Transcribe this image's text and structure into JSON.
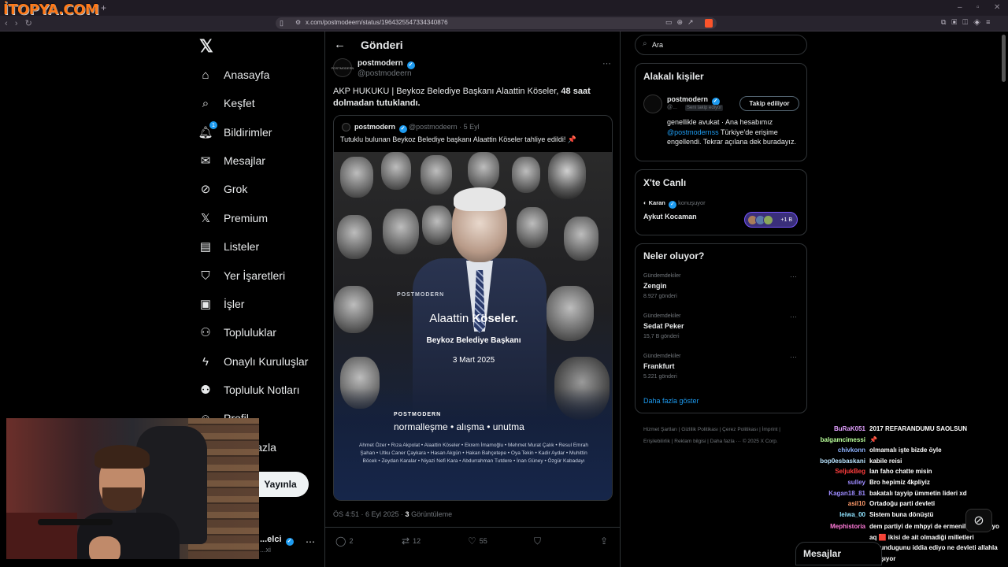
{
  "browser": {
    "stamp": "İTOPYA.COM",
    "url": "x.com/postmodeern/status/1964325547334340876"
  },
  "nav": {
    "items": [
      {
        "label": "Anasayfa",
        "icon": "home-icon"
      },
      {
        "label": "Keşfet",
        "icon": "search-icon"
      },
      {
        "label": "Bildirimler",
        "icon": "bell-icon",
        "badge": "1"
      },
      {
        "label": "Mesajlar",
        "icon": "mail-icon"
      },
      {
        "label": "Grok",
        "icon": "grok-icon"
      },
      {
        "label": "Premium",
        "icon": "x-logo-icon"
      },
      {
        "label": "Listeler",
        "icon": "list-icon"
      },
      {
        "label": "Yer İşaretleri",
        "icon": "bookmark-icon"
      },
      {
        "label": "İşler",
        "icon": "briefcase-icon"
      },
      {
        "label": "Topluluklar",
        "icon": "people-icon"
      },
      {
        "label": "Onaylı Kuruluşlar",
        "icon": "lightning-icon"
      },
      {
        "label": "Topluluk Notları",
        "icon": "community-notes-icon"
      },
      {
        "label": "Profil",
        "icon": "profile-icon"
      },
      {
        "label": "Daha fazla",
        "icon": "more-icon"
      }
    ],
    "post_button": "Yayınla",
    "account_name": "...elci",
    "account_handle": "...xi"
  },
  "post": {
    "page_title": "Gönderi",
    "author_name": "postmodern",
    "author_handle": "@postmodeern",
    "avatar_text": "POSTMODERN",
    "text_plain": "AKP HUKUKU | Beykoz Belediye Başkanı Alaattin Köseler, ",
    "text_bold": "48 saat dolmadan tutuklandı.",
    "time": "ÖS 4:51 · 6 Eyl 2025 · ",
    "views_count": "3",
    "views_label": " Görüntüleme",
    "stats": {
      "replies": "2",
      "reposts": "12",
      "likes": "55"
    }
  },
  "quote": {
    "author_name": "postmodern",
    "author_handle": "@postmodeern · 5 Eyl",
    "text": "Tutuklu bulunan Beykoz Belediye başkanı Alaattin Köseler tahliye edildi! 📌",
    "image": {
      "brand": "POSTMODERN",
      "name_first": "Alaattin ",
      "name_last": "Köseler.",
      "title": "Beykoz Belediye Başkanı",
      "date": "3 Mart 2025",
      "brand2": "POSTMODERN",
      "slogan": "normalleşme • alışma • unutma",
      "names": "Ahmet Özer • Rıza Akpolat • Alaattin Köseler • Ekrem İmamoğlu • Mehmet Murat Çalık • Resul Emrah Şahan • Utku Caner Çaykara • Hasan Akgün • Hakan Bahçetepe • Oya Tekin • Kadir Aydar • Muhittin Böcek • Zeydan Karalar • Niyazi Nefi Kara • Abdurrahman Tutdere • İnan Güney • Özgür Kabadayı"
    }
  },
  "sidebar": {
    "search_placeholder": "Ara",
    "related_title": "Alakalı kişiler",
    "related": {
      "name": "postmodern",
      "handle": "@...",
      "follows_you": "Seni takip ediyor",
      "button": "Takip ediliyor",
      "bio_1": "genellikle avukat · Ana hesabımız ",
      "bio_link": "@postmodernss",
      "bio_2": " Türkiye'de erişime engellendi. Tekrar açılana dek buradayız."
    },
    "live_title": "X'te Canlı",
    "live": {
      "host": "Karan",
      "status": " konuşuyor",
      "title": "Aykut Kocaman",
      "listeners": "+1 B"
    },
    "trends_title": "Neler oluyor?",
    "trends": [
      {
        "category": "Gündemdekiler",
        "name": "Zengin",
        "count": "8.927 gönderi"
      },
      {
        "category": "Gündemdekiler",
        "name": "Sedat Peker",
        "count": "15,7 B gönderi"
      },
      {
        "category": "Gündemdekiler",
        "name": "Frankfurt",
        "count": "5.221 gönderi"
      }
    ],
    "show_more": "Daha fazla göster",
    "footer": "Hizmet Şartları  |  Gizlilik Politikası  |  Çerez Politikası  |  İmprint  |  Erişilebilirlik  |  Reklam bilgisi  |  Daha fazla ···  © 2025 X Corp."
  },
  "chat": [
    {
      "user": "BuRaK051",
      "msg": "2017 REFARANDUMU SAOLSUN",
      "color": "#e2a0ff"
    },
    {
      "user": "balgamcimessi",
      "msg": "📌",
      "color": "#b9ff9a"
    },
    {
      "user": "chivkonn",
      "msg": "olmamalı işte bizde öyle",
      "color": "#8fb4ff"
    },
    {
      "user": "bop0esbaskani",
      "msg": "kabile reisi",
      "color": "#b9e4ff"
    },
    {
      "user": "SeljukBeg",
      "msg": "lan faho chatte misin",
      "color": "#ff3d3d"
    },
    {
      "user": "sulley",
      "msg": "Bro hepimiz 4kpliyiz",
      "color": "#9d8bff"
    },
    {
      "user": "Kagan18_81",
      "msg": "bakatalı tayyip ümmetin lideri xd",
      "color": "#9d8bff"
    },
    {
      "user": "asil10",
      "msg": "Ortadoğu parti devleti",
      "color": "#ff9b6b"
    },
    {
      "user": "leiwa_00",
      "msg": "Sistem buna dönüştü",
      "color": "#8fe3ff"
    },
    {
      "user": "Mephistoria",
      "msg": "dem partiyi de mhpyi de ermeniler yönetiyo aq 🟥 ikisi de ait olmadiği milletleri savundugunu iddia ediyo ne devleti allahla yarışıyor",
      "color": "#ff7ad9"
    },
    {
      "user": "dnddasheist",
      "msg": "",
      "color": "#ffcf6b"
    }
  ],
  "dm": {
    "label": "Mesajlar"
  }
}
